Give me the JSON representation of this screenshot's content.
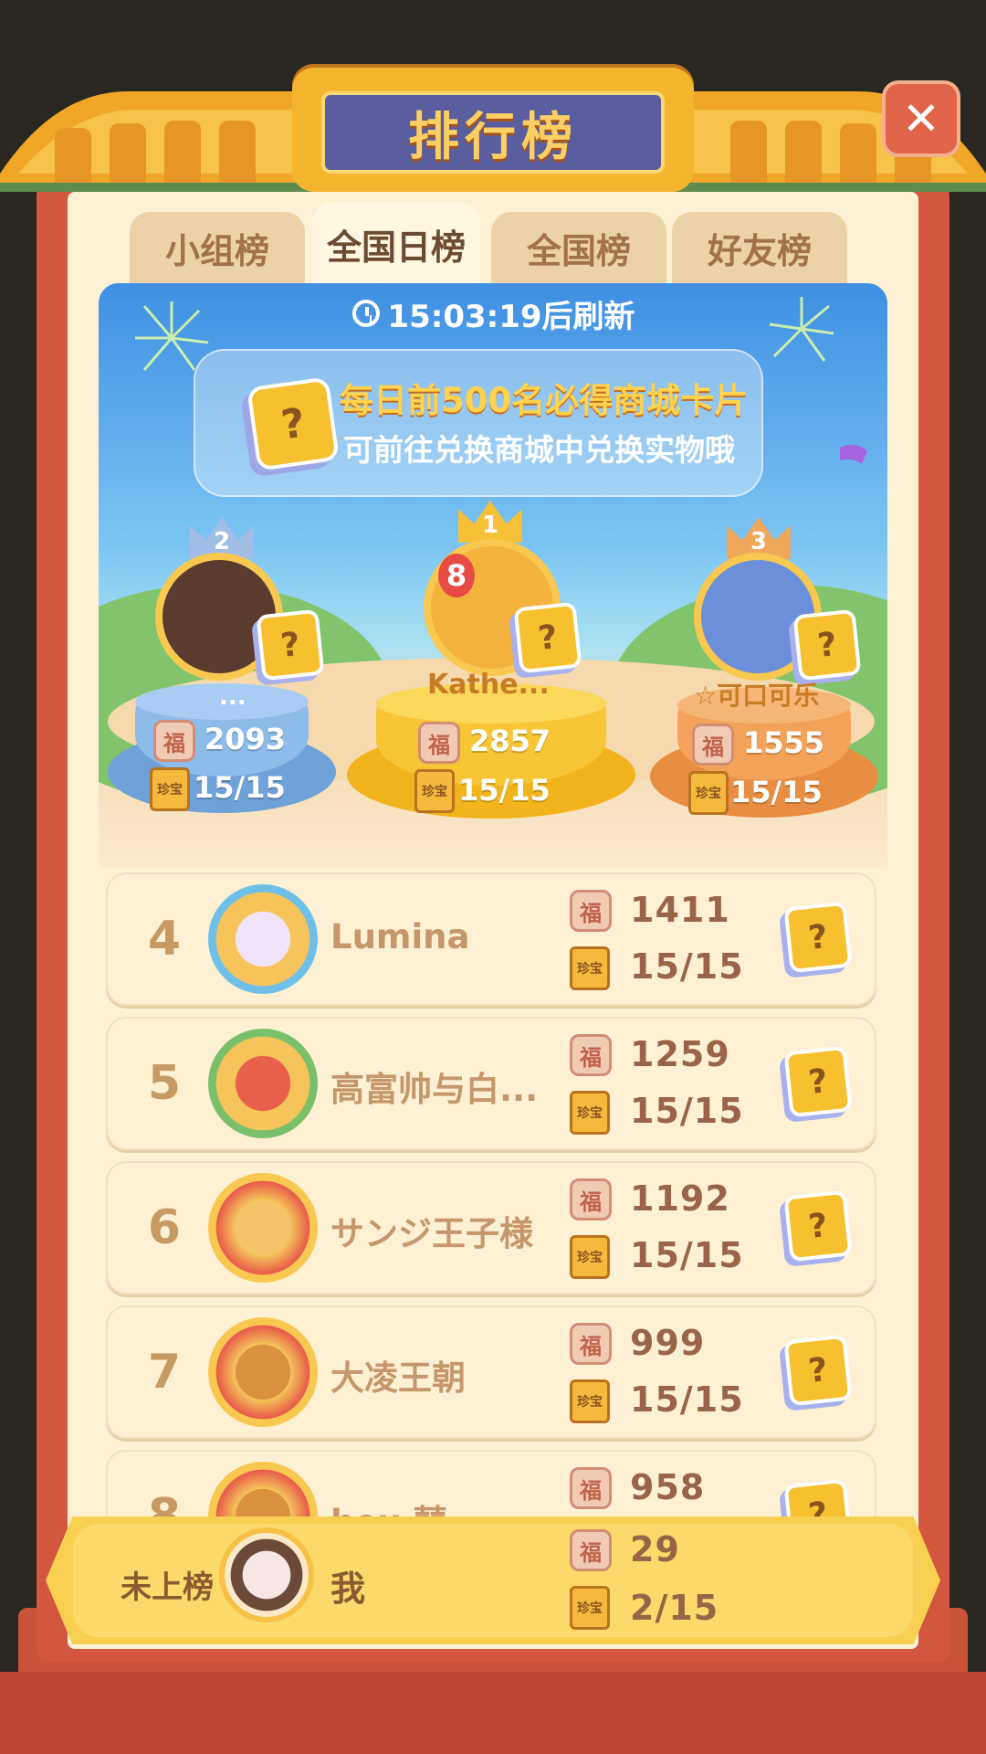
{
  "header": {
    "title": "排行榜",
    "close_icon": "close-icon"
  },
  "tabs": [
    {
      "label": "小组榜",
      "active": false
    },
    {
      "label": "全国日榜",
      "active": true
    },
    {
      "label": "全国榜",
      "active": false
    },
    {
      "label": "好友榜",
      "active": false
    }
  ],
  "banner": {
    "refresh_text": "15:03:19后刷新",
    "reward_line1": "每日前500名必得商城卡片",
    "reward_line2": "可前往兑换商城中兑换实物哦",
    "card_mark": "?"
  },
  "podium": [
    {
      "rank": "1",
      "name": "Kathe...",
      "score": "2857",
      "progress": "15/15",
      "badge_digit": "8"
    },
    {
      "rank": "2",
      "name": "...",
      "score": "2093",
      "progress": "15/15"
    },
    {
      "rank": "3",
      "name": "☆可口可乐",
      "score": "1555",
      "progress": "15/15"
    }
  ],
  "icons": {
    "fu": "福",
    "book": "珍宝"
  },
  "rows": [
    {
      "rank": "4",
      "name": "Lumina",
      "score": "1411",
      "progress": "15/15"
    },
    {
      "rank": "5",
      "name": "高富帅与白...",
      "score": "1259",
      "progress": "15/15"
    },
    {
      "rank": "6",
      "name": "サンジ王子様",
      "score": "1192",
      "progress": "15/15"
    },
    {
      "rank": "7",
      "name": "大凌王朝",
      "score": "999",
      "progress": "15/15"
    },
    {
      "rank": "8",
      "name": "heu    囍",
      "score": "958",
      "progress": ""
    }
  ],
  "me": {
    "status": "未上榜",
    "name": "我",
    "score": "29",
    "progress": "2/15"
  },
  "colors": {
    "frame": "#d2573e",
    "panel": "#fdf1d5",
    "gold": "#f9c850",
    "tab_inactive": "#ecd3a7"
  }
}
